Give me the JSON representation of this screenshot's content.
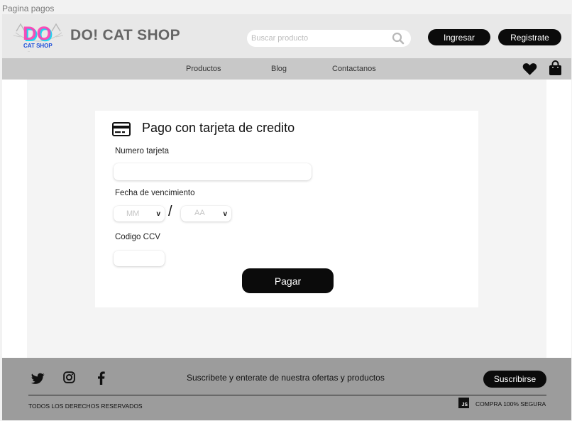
{
  "frame_label": "Pagina pagos",
  "header": {
    "logo": {
      "big": "DO",
      "small": "CAT SHOP",
      "tagline": "..."
    },
    "brand": "DO! CAT SHOP",
    "search_placeholder": "Buscar producto",
    "login_label": "Ingresar",
    "register_label": "Registrate"
  },
  "nav": {
    "items": [
      "Productos",
      "Blog",
      "Contactanos"
    ],
    "icons": [
      "heart-icon",
      "shopping-bag-icon"
    ]
  },
  "payment": {
    "title": "Pago con tarjeta de credito",
    "card_number_label": "Numero tarjeta",
    "card_number_value": "",
    "expiry_label": "Fecha de vencimiento",
    "month_placeholder": "MM",
    "year_placeholder": "AA",
    "separator": "/",
    "ccv_label": "Codigo CCV",
    "ccv_value": "",
    "pay_label": "Pagar"
  },
  "footer": {
    "social_icons": [
      "twitter-icon",
      "instagram-icon",
      "facebook-icon"
    ],
    "subscribe_text": "Suscribete y enterate de nuestra ofertas y productos",
    "subscribe_label": "Suscribirse",
    "rights": "TODOS LOS DERECHOS RESERVADOS",
    "js_badge": "JS",
    "secure": "COMPRA 100% SEGURA"
  },
  "colors": {
    "header_bg": "#e8e8e8",
    "nav_bg": "#c8c8c8",
    "footer_bg": "#9c9c9c",
    "button_dark": "#0b0b0b",
    "logo_pink": "#ff3fb4",
    "logo_cyan": "#22d3ee"
  }
}
